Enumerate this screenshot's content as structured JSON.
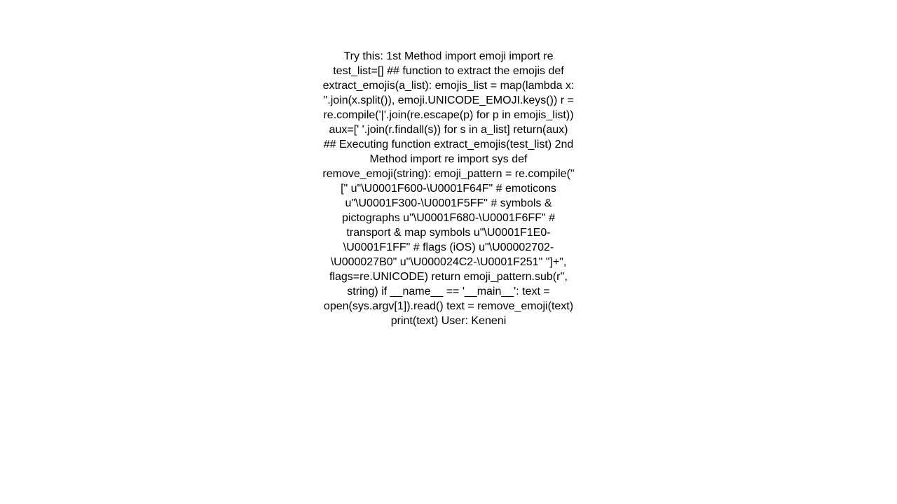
{
  "page": {
    "background_color": "#ffffff",
    "text_color": "#000000"
  },
  "answer": {
    "body": "Try this: 1st Method import emoji import re  test_list=[]  ## function to extract the emojis def extract_emojis(a_list):     emojis_list = map(lambda x: ''.join(x.split()), emoji.UNICODE_EMOJI.keys())     r = re.compile('|'.join(re.escape(p) for p in emojis_list))     aux=[' '.join(r.findall(s)) for s in a_list]     return(aux)  ## Executing function extract_emojis(test_list)  2nd Method import re import sys def remove_emoji(string):     emoji_pattern = re.compile(\"[\" u\"\\U0001F600-\\U0001F64F\"  # emoticons u\"\\U0001F300-\\U0001F5FF\"  # symbols & pictographs u\"\\U0001F680-\\U0001F6FF\"  # transport & map symbols u\"\\U0001F1E0-\\U0001F1FF\"  # flags (iOS) u\"\\U00002702-\\U000027B0\" u\"\\U000024C2-\\U0001F251\" \"]+\", flags=re.UNICODE)     return emoji_pattern.sub(r'', string) if __name__ == '__main__':  text = open(sys.argv[1]).read() text = remove_emoji(text) print(text)   User: Keneni"
  }
}
